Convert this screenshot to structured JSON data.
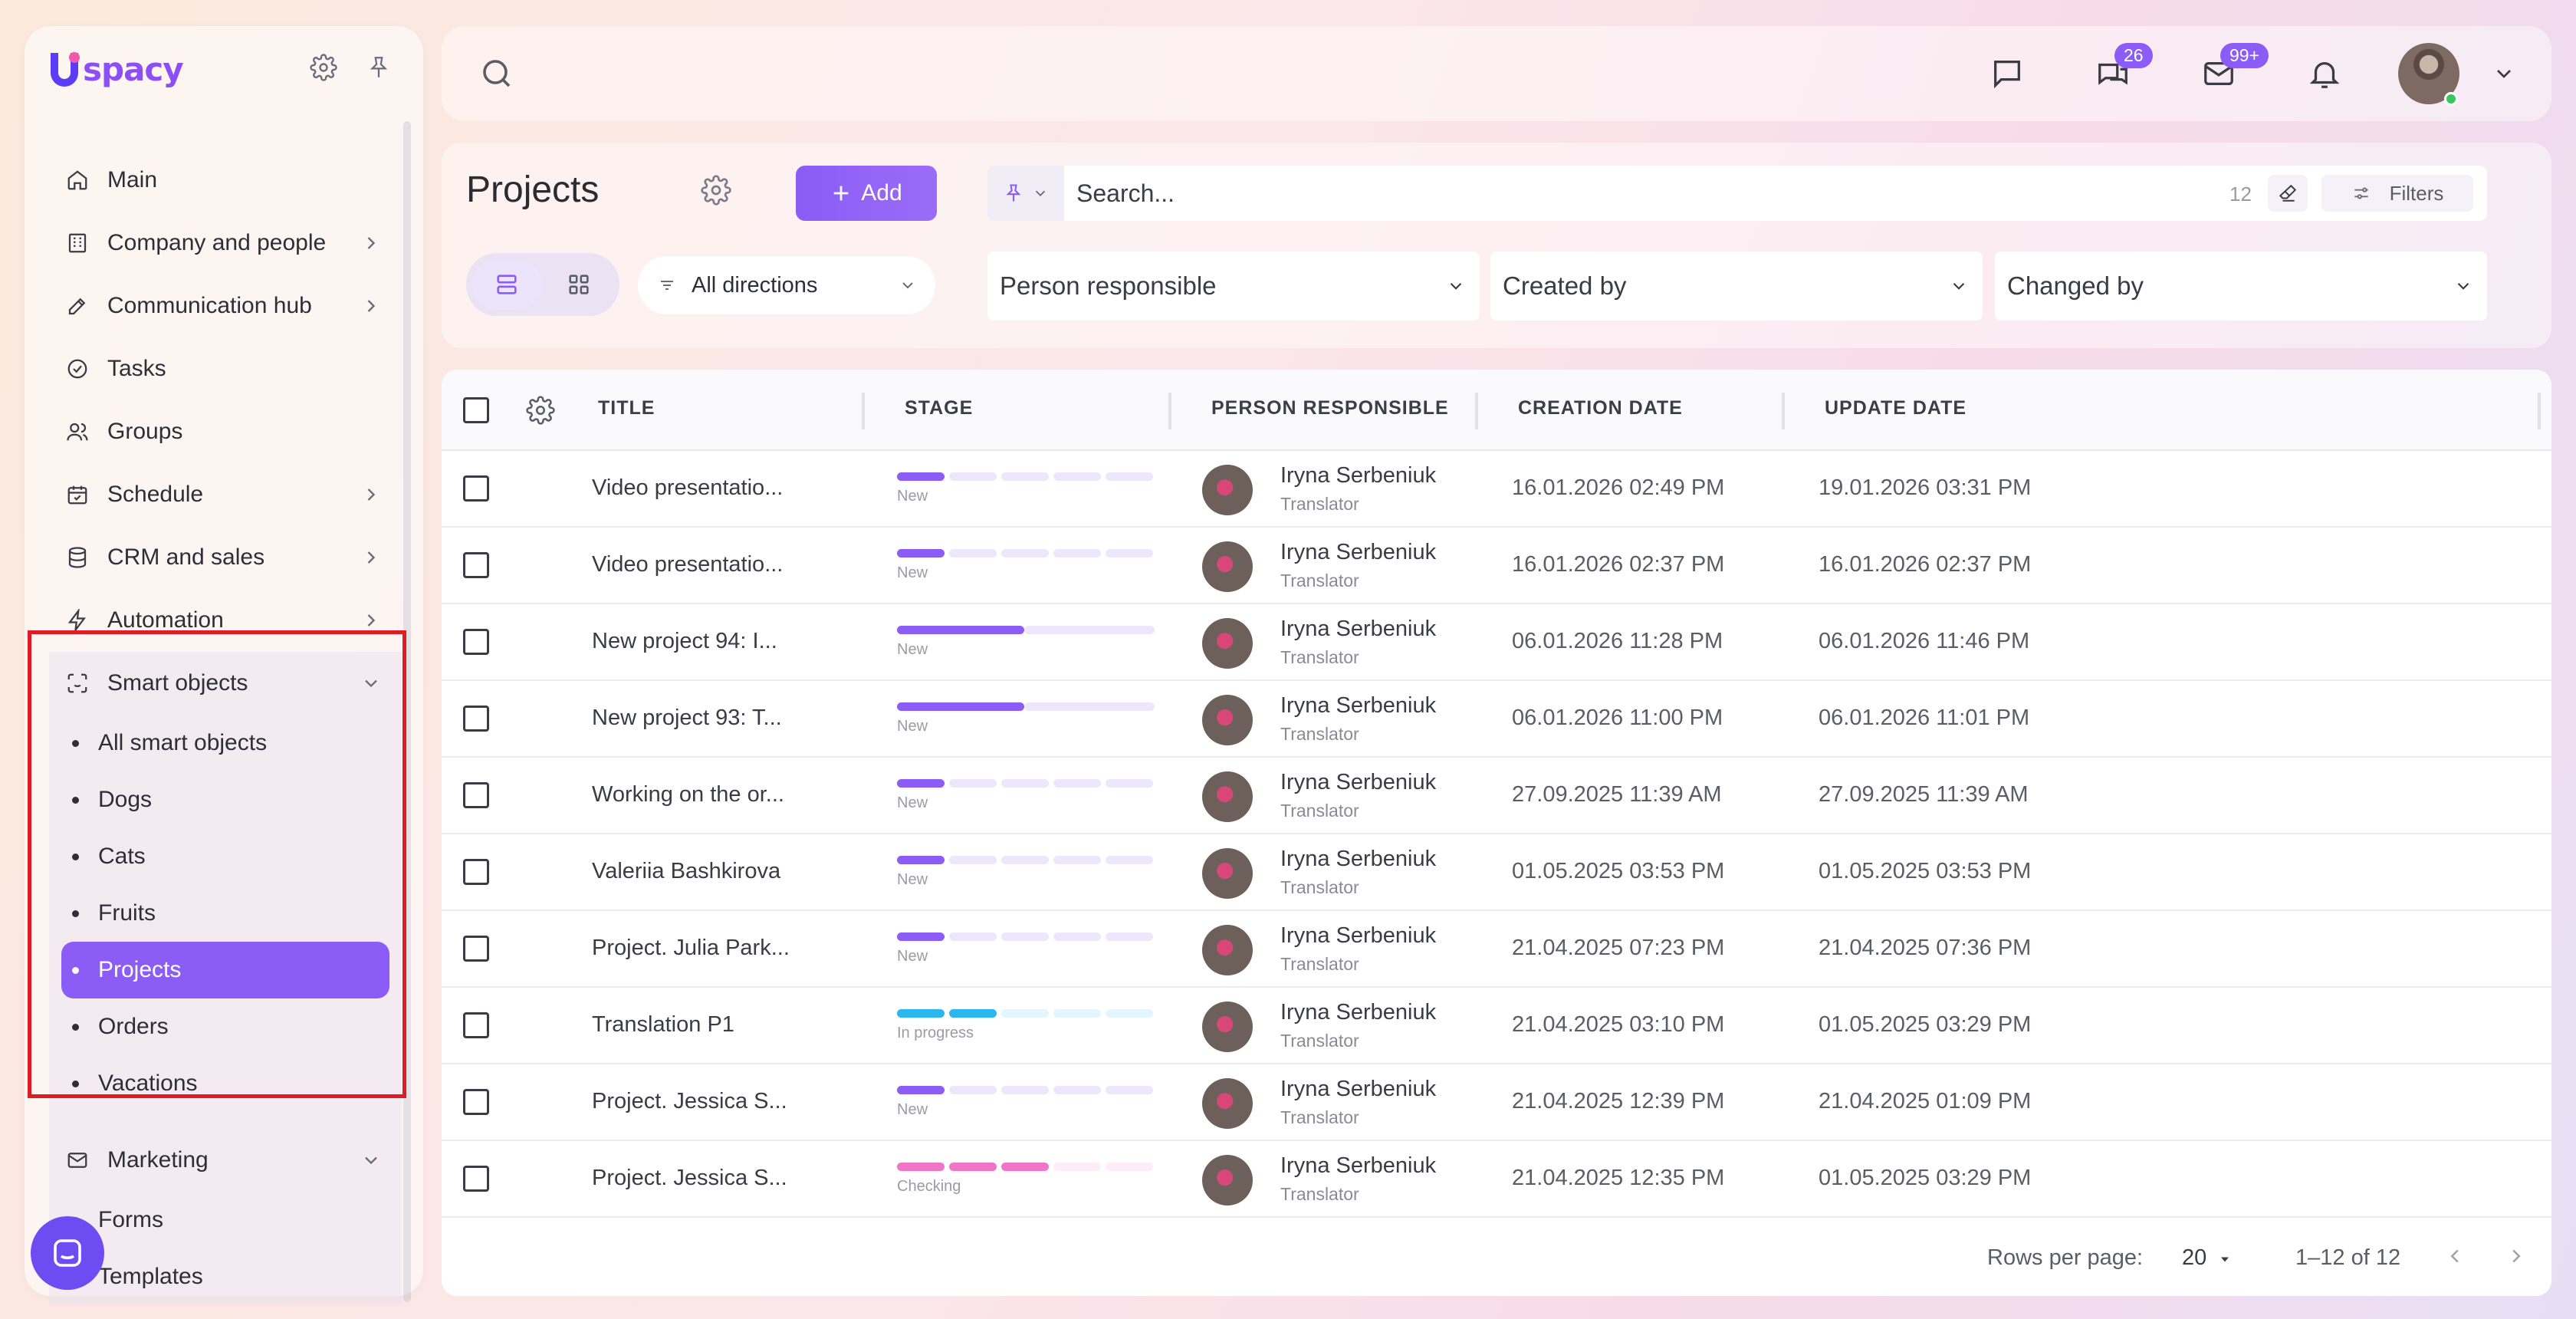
{
  "app": {
    "logo_text": "spacy"
  },
  "sidebar": {
    "items": [
      {
        "label": "Main"
      },
      {
        "label": "Company and people"
      },
      {
        "label": "Communication hub"
      },
      {
        "label": "Tasks"
      },
      {
        "label": "Groups"
      },
      {
        "label": "Schedule"
      },
      {
        "label": "CRM and sales"
      },
      {
        "label": "Automation"
      },
      {
        "label": "Smart objects"
      },
      {
        "label": "Marketing"
      }
    ],
    "smart_objects": [
      "All smart objects",
      "Dogs",
      "Cats",
      "Fruits",
      "Projects",
      "Orders",
      "Vacations"
    ],
    "marketing": [
      "Forms",
      "Templates"
    ]
  },
  "topbar": {
    "chats_badge": "26",
    "mail_badge": "99+"
  },
  "page": {
    "title": "Projects",
    "add_label": "Add",
    "search_placeholder": "Search...",
    "search_count": "12",
    "filters_label": "Filters",
    "direction": "All directions",
    "person_responsible": "Person responsible",
    "created_by": "Created by",
    "changed_by": "Changed by"
  },
  "table": {
    "columns": [
      "TITLE",
      "STAGE",
      "PERSON RESPONSIBLE",
      "CREATION DATE",
      "UPDATE DATE"
    ],
    "rows": [
      {
        "title": "Video presentatio...",
        "stage": "New",
        "progress": 1,
        "stage_color": "#8b5cf6",
        "person": "Iryna Serbeniuk",
        "role": "Translator",
        "created": "16.01.2026 02:49 PM",
        "updated": "19.01.2026 03:31 PM"
      },
      {
        "title": "Video presentatio...",
        "stage": "New",
        "progress": 1,
        "stage_color": "#8b5cf6",
        "person": "Iryna Serbeniuk",
        "role": "Translator",
        "created": "16.01.2026 02:37 PM",
        "updated": "16.01.2026 02:37 PM"
      },
      {
        "title": "New project 94: I...",
        "stage": "New",
        "progress": 1,
        "stage_color": "#8b5cf6",
        "person": "Iryna Serbeniuk",
        "role": "Translator",
        "created": "06.01.2026 11:28 PM",
        "updated": "06.01.2026 11:46 PM",
        "two_seg": true
      },
      {
        "title": "New project 93: T...",
        "stage": "New",
        "progress": 1,
        "stage_color": "#8b5cf6",
        "person": "Iryna Serbeniuk",
        "role": "Translator",
        "created": "06.01.2026 11:00 PM",
        "updated": "06.01.2026 11:01 PM",
        "two_seg": true
      },
      {
        "title": "Working on the or...",
        "stage": "New",
        "progress": 1,
        "stage_color": "#8b5cf6",
        "person": "Iryna Serbeniuk",
        "role": "Translator",
        "created": "27.09.2025 11:39 AM",
        "updated": "27.09.2025 11:39 AM"
      },
      {
        "title": "Valeriia Bashkirova",
        "stage": "New",
        "progress": 1,
        "stage_color": "#8b5cf6",
        "person": "Iryna Serbeniuk",
        "role": "Translator",
        "created": "01.05.2025 03:53 PM",
        "updated": "01.05.2025 03:53 PM"
      },
      {
        "title": "Project. Julia Park...",
        "stage": "New",
        "progress": 1,
        "stage_color": "#8b5cf6",
        "person": "Iryna Serbeniuk",
        "role": "Translator",
        "created": "21.04.2025 07:23 PM",
        "updated": "21.04.2025 07:36 PM"
      },
      {
        "title": "Translation P1",
        "stage": "In progress",
        "progress": 2,
        "stage_color": "#2bb6ef",
        "person": "Iryna Serbeniuk",
        "role": "Translator",
        "created": "21.04.2025 03:10 PM",
        "updated": "01.05.2025 03:29 PM"
      },
      {
        "title": "Project. Jessica S...",
        "stage": "New",
        "progress": 1,
        "stage_color": "#8b5cf6",
        "person": "Iryna Serbeniuk",
        "role": "Translator",
        "created": "21.04.2025 12:39 PM",
        "updated": "21.04.2025 01:09 PM"
      },
      {
        "title": "Project. Jessica S...",
        "stage": "Checking",
        "progress": 3,
        "stage_color": "#f075c8",
        "person": "Iryna Serbeniuk",
        "role": "Translator",
        "created": "21.04.2025 12:35 PM",
        "updated": "01.05.2025 03:29 PM"
      }
    ]
  },
  "pagination": {
    "rows_per_page_label": "Rows per page:",
    "rows_per_page": "20",
    "range": "1–12 of 12"
  }
}
